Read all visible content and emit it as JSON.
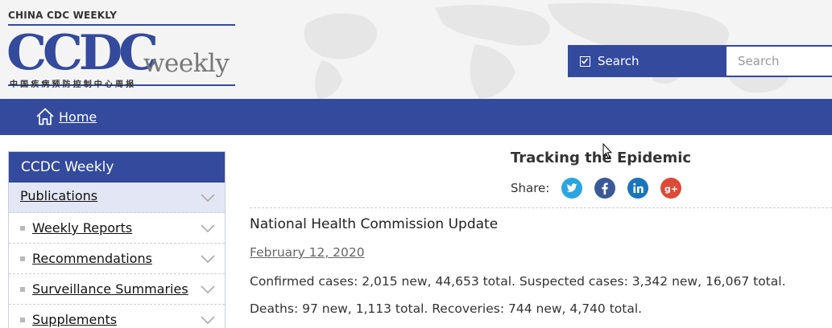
{
  "logo": {
    "top_text": "CHINA CDC WEEKLY",
    "big_text": "CCDC",
    "weekly_text": "weekly",
    "chinese_text": "中国疾病预防控制中心周报"
  },
  "search": {
    "toggle_label": "Search",
    "placeholder": "Search",
    "value": ""
  },
  "nav": {
    "home_label": "Home"
  },
  "sidebar": {
    "title": "CCDC Weekly",
    "items": [
      {
        "label": "Publications"
      },
      {
        "label": "Weekly Reports"
      },
      {
        "label": "Recommendations"
      },
      {
        "label": "Surveillance Summaries"
      },
      {
        "label": "Supplements"
      }
    ]
  },
  "main": {
    "title": "Tracking the Epidemic",
    "share_label": "Share:",
    "social_icons": [
      "twitter-icon",
      "facebook-icon",
      "linkedin-icon",
      "google-plus-icon"
    ],
    "update": {
      "heading": "National Health Commission Update",
      "date": "February 12, 2020",
      "line1": "Confirmed cases: 2,015 new, 44,653 total. Suspected cases: 3,342 new, 16,067 total.",
      "line2": "Deaths: 97 new, 1,113 total. Recoveries: 744 new, 4,740 total."
    }
  },
  "colors": {
    "brand_blue": "#334a9d",
    "twitter": "#2ba5e0",
    "facebook": "#3b5998",
    "linkedin": "#1b75bb",
    "google_plus": "#dc4a38"
  }
}
